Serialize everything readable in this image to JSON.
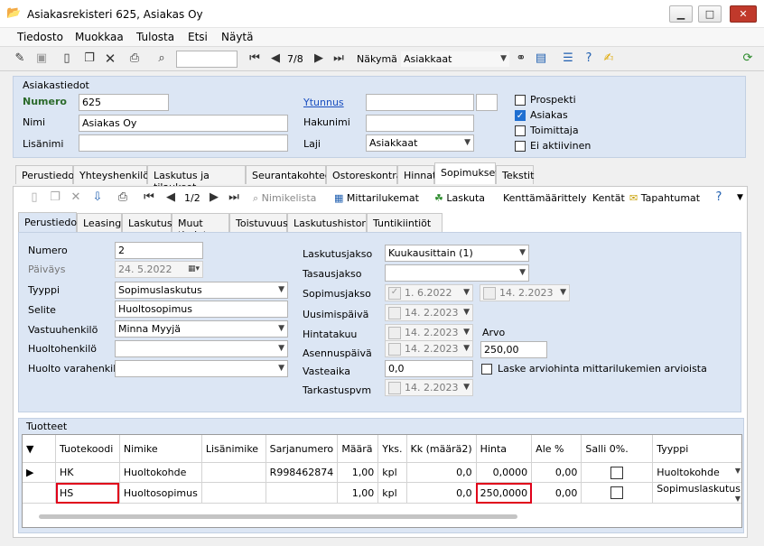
{
  "window": {
    "title": "Asiakasrekisteri 625, Asiakas Oy",
    "minimize": "▁",
    "maximize": "□",
    "close": "✕"
  },
  "menu": [
    "Tiedosto",
    "Muokkaa",
    "Tulosta",
    "Etsi",
    "Näytä"
  ],
  "toolbar": {
    "record_pos": "7/8",
    "view_label": "Näkymä",
    "view_value": "Asiakkaat"
  },
  "customer": {
    "group_label": "Asiakastiedot",
    "numero_label": "Numero",
    "numero": "625",
    "nimi_label": "Nimi",
    "nimi": "Asiakas Oy",
    "lisanimi_label": "Lisänimi",
    "lisanimi": "",
    "ytunnus_label": "Ytunnus",
    "ytunnus": "",
    "hakunimi_label": "Hakunimi",
    "hakunimi": "",
    "laji_label": "Laji",
    "laji": "Asiakkaat",
    "checks": [
      {
        "label": "Prospekti",
        "checked": false
      },
      {
        "label": "Asiakas",
        "checked": true
      },
      {
        "label": "Toimittaja",
        "checked": false
      },
      {
        "label": "Ei aktiivinen",
        "checked": false
      }
    ]
  },
  "main_tabs": [
    "Perustiedot",
    "Yhteyshenkilöt",
    "Laskutus ja tilaukset",
    "Seurantakohteet",
    "Ostoreskontra",
    "Hinnat",
    "Sopimukset",
    "Tekstit"
  ],
  "contract_toolbar": {
    "pos": "1/2",
    "nimikelista": "Nimikelista",
    "mittarilukemat": "Mittarilukemat",
    "laskuta": "Laskuta",
    "kenttamaarittely": "Kenttämäärittely",
    "kentat": "Kentät",
    "tapahtumat": "Tapahtumat"
  },
  "sub_tabs": [
    "Perustiedot",
    "Leasing",
    "Laskutus",
    "Muut tiedot",
    "Toistuvuus",
    "Laskutushistoria",
    "Tuntikiintiöt"
  ],
  "contract": {
    "numero_label": "Numero",
    "numero": "2",
    "paivays_label": "Päiväys",
    "paivays": "24. 5.2022",
    "tyyppi_label": "Tyyppi",
    "tyyppi": "Sopimuslaskutus",
    "selite_label": "Selite",
    "selite": "Huoltosopimus",
    "vastuuhenkilo_label": "Vastuuhenkilö",
    "vastuuhenkilo": "Minna Myyjä",
    "huoltohenkilo_label": "Huoltohenkilö",
    "huoltohenkilo": "",
    "huolto_varahenkilo_label": "Huolto varahenkilö",
    "huolto_varahenkilo": "",
    "laskutusjakso_label": "Laskutusjakso",
    "laskutusjakso": "Kuukausittain (1)",
    "tasausjakso_label": "Tasausjakso",
    "tasausjakso": "",
    "sopimusjakso_label": "Sopimusjakso",
    "sopimusjakso_start": "1. 6.2022",
    "sopimusjakso_end": "14. 2.2023",
    "uusimispaiva_label": "Uusimispäivä",
    "uusimispaiva": "14. 2.2023",
    "hintatakuu_label": "Hintatakuu",
    "hintatakuu": "14. 2.2023",
    "asennuspaiva_label": "Asennuspäivä",
    "asennuspaiva": "14. 2.2023",
    "arvo_label": "Arvo",
    "arvo": "250,00",
    "vasteaika_label": "Vasteaika",
    "vasteaika": "0,0",
    "laske_label": "Laske arviohinta mittarilukemien arvioista",
    "tarkastuspvm_label": "Tarkastuspvm",
    "tarkastuspvm": "14. 2.2023"
  },
  "products": {
    "group_label": "Tuotteet",
    "columns": [
      "Tuotekoodi",
      "Nimike",
      "Lisänimike",
      "Sarjanumero",
      "Määrä",
      "Yks.",
      "Kk (määrä2)",
      "Hinta",
      "Ale %",
      "Salli 0%.",
      "Tyyppi"
    ],
    "rows": [
      {
        "tuotekoodi": "HK",
        "nimike": "Huoltokohde",
        "lisanimike": "",
        "sarjanumero": "R998462874",
        "maara": "1,00",
        "yks": "kpl",
        "kk": "0,0",
        "hinta": "0,0000",
        "ale": "0,00",
        "tyyppi": "Huoltokohde"
      },
      {
        "tuotekoodi": "HS",
        "nimike": "Huoltosopimus",
        "lisanimike": "",
        "sarjanumero": "",
        "maara": "1,00",
        "yks": "kpl",
        "kk": "0,0",
        "hinta": "250,0000",
        "ale": "0,00",
        "tyyppi": "Sopimuslaskutus"
      }
    ]
  }
}
